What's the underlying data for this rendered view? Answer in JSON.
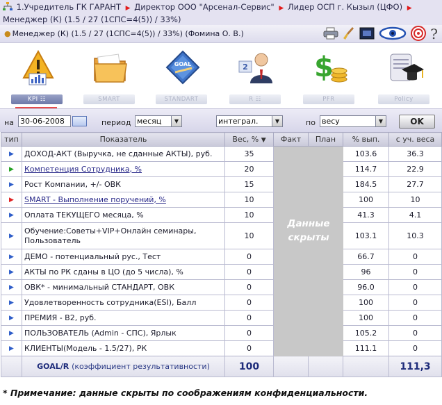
{
  "breadcrumb": {
    "items": [
      "1.Учредитель ГК ГАРАНТ",
      "Директор ООО \"Арсенал-Сервис\"",
      "Лидер ОСП г. Кызыл (ЦФО)",
      "Менеджер (К) (1.5 / 27 (1СПС=4(5)) / 33%)"
    ]
  },
  "user": {
    "label": "Менеджер (К) (1.5 / 27 (1СПС=4(5)) / 33%)  (Фомина О. В.)"
  },
  "toolbar": {
    "icons": [
      "printer-icon",
      "brush-icon",
      "screen-icon",
      "eye-icon",
      "target-icon",
      "help-icon"
    ],
    "help_label": "?"
  },
  "tabs": [
    {
      "label": "KPI ☷",
      "icon": "warning-chart-icon",
      "active": true
    },
    {
      "label": "SMART",
      "icon": "folder-icon",
      "active": false
    },
    {
      "label": "STANDART",
      "icon": "goal-badge-icon",
      "active": false
    },
    {
      "label": "R ☷",
      "icon": "manager-icon",
      "active": false
    },
    {
      "label": "PFR",
      "icon": "dollar-coins-icon",
      "active": false
    },
    {
      "label": "Policy",
      "icon": "diploma-icon",
      "active": false
    }
  ],
  "filter": {
    "date_label": "на",
    "date_value": "30-06-2008",
    "period_label": "период",
    "period_value": "месяц",
    "mode_value": "интеграл.",
    "sort_label": "по",
    "sort_value": "весу",
    "ok_label": "OK"
  },
  "table": {
    "headers": {
      "type": "тип",
      "indicator": "Показатель",
      "weight": "Вес, %",
      "fact": "Факт",
      "plan": "План",
      "pct": "% вып.",
      "weighted": "с уч. веса"
    },
    "rows": [
      {
        "arrow": "blue",
        "name": "ДОХОД-АКТ (Выручка, не сданные АКТЫ), руб.",
        "link": false,
        "weight": "35",
        "pct": "103.6",
        "weighted": "36.3"
      },
      {
        "arrow": "green",
        "name": "Компетенция Сотрудника, %",
        "link": true,
        "weight": "20",
        "pct": "114.7",
        "weighted": "22.9"
      },
      {
        "arrow": "blue",
        "name": "Рост Компании, +/- ОВК",
        "link": false,
        "weight": "15",
        "pct": "184.5",
        "weighted": "27.7"
      },
      {
        "arrow": "red",
        "name": "SMART - Выполнение поручений, %",
        "link": true,
        "weight": "10",
        "pct": "100",
        "weighted": "10"
      },
      {
        "arrow": "blue",
        "name": "Оплата ТЕКУЩЕГО месяца, %",
        "link": false,
        "weight": "10",
        "pct": "41.3",
        "weighted": "4.1"
      },
      {
        "arrow": "blue",
        "name": "Обучение:Советы+VIP+Онлайн семинары, Пользователь",
        "link": false,
        "weight": "10",
        "pct": "103.1",
        "weighted": "10.3",
        "tall": true
      },
      {
        "arrow": "blue",
        "name": "ДЕМО - потенциальный рус., Тест",
        "link": false,
        "weight": "0",
        "pct": "66.7",
        "weighted": "0"
      },
      {
        "arrow": "blue",
        "name": "АКТЫ по РК сданы в ЦО (до 5 числа), %",
        "link": false,
        "weight": "0",
        "pct": "96",
        "weighted": "0"
      },
      {
        "arrow": "blue",
        "name": "ОВК* - минимальный СТАНДАРТ, ОВК",
        "link": false,
        "weight": "0",
        "pct": "96.0",
        "weighted": "0"
      },
      {
        "arrow": "blue",
        "name": "Удовлетворенность сотрудника(ESI), Балл",
        "link": false,
        "weight": "0",
        "pct": "100",
        "weighted": "0"
      },
      {
        "arrow": "blue",
        "name": "ПРЕМИЯ - В2, руб.",
        "link": false,
        "weight": "0",
        "pct": "100",
        "weighted": "0"
      },
      {
        "arrow": "blue",
        "name": "ПОЛЬЗОВАТЕЛЬ (Admin - СПС), Ярлык",
        "link": false,
        "weight": "0",
        "pct": "105.2",
        "weighted": "0"
      },
      {
        "arrow": "blue",
        "name": "КЛИЕНТЫ(Модель - 1.5/27), РК",
        "link": false,
        "weight": "0",
        "pct": "111.1",
        "weighted": "0"
      }
    ],
    "footer": {
      "goal": "GOAL/R",
      "goal_desc": "(коэффициент результативности)",
      "total_weight": "100",
      "total_result": "111,3"
    },
    "hidden_text": "Данные скрыты"
  },
  "note": "* Примечание: данные скрыты по соображениям конфиденциальности.",
  "colors": {
    "arrow_blue": "#2f5ec9",
    "arrow_green": "#27a327",
    "arrow_red": "#e02222",
    "active_tab_underline": "#e64b4b"
  }
}
